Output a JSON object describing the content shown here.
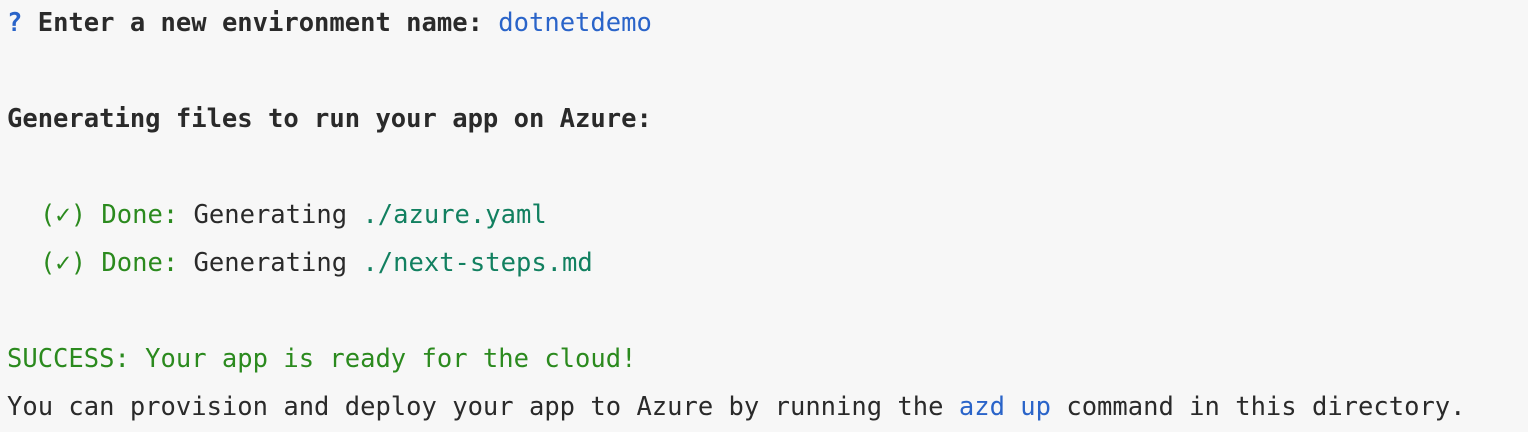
{
  "prompt": {
    "marker": "?",
    "question": "Enter a new environment name:",
    "answer": "dotnetdemo"
  },
  "heading": "Generating files to run your app on Azure:",
  "steps": [
    {
      "check": "(✓)",
      "status": "Done:",
      "action": "Generating",
      "file": "./azure.yaml"
    },
    {
      "check": "(✓)",
      "status": "Done:",
      "action": "Generating",
      "file": "./next-steps.md"
    }
  ],
  "success": "SUCCESS: Your app is ready for the cloud!",
  "instruction": {
    "before": "You can provision and deploy your app to Azure by running the",
    "command": "azd up",
    "after": "command in this directory."
  },
  "colors": {
    "background": "#f7f7f7",
    "text": "#2a2a2a",
    "prompt_blue": "#2a64c9",
    "success_green": "#2b8a1e",
    "file_teal": "#128060"
  }
}
